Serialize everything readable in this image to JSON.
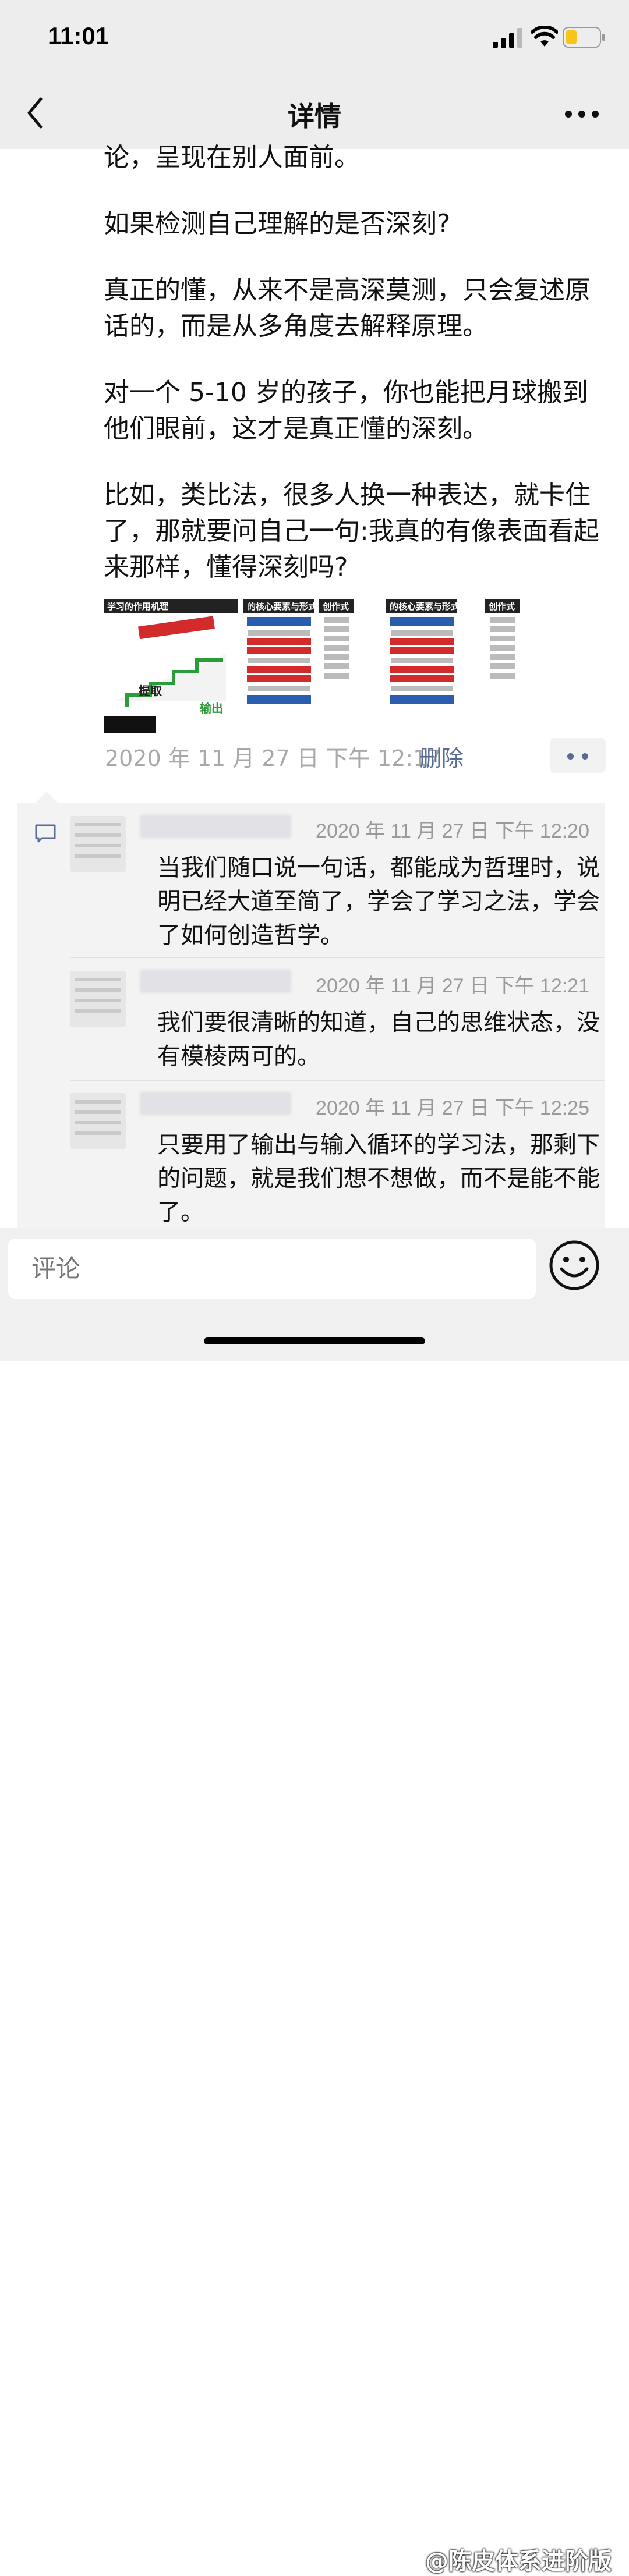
{
  "status_bar": {
    "time": "11:01"
  },
  "nav": {
    "title": "详情"
  },
  "post": {
    "paragraphs": [
      "论，呈现在别人面前。",
      "如果检测自己理解的是否深刻?",
      "真正的懂，从来不是高深莫测，只会复述原话的，而是从多角度去解释原理。",
      "对一个 5-10 岁的孩子，你也能把月球搬到他们眼前，这才是真正懂的深刻。",
      "比如，类比法，很多人换一种表达，就卡住了，那就要问自己一句:我真的有像表面看起来那样，懂得深刻吗?"
    ],
    "thumbnails": [
      {
        "header": "学习的作用机理",
        "tag1": "提取",
        "tag2": "输出"
      },
      {
        "header": "的核心要素与形式"
      },
      {
        "header": "创作式"
      },
      {
        "header": "的核心要素与形式"
      },
      {
        "header": "创作式"
      }
    ],
    "time": "2020 年 11 月 27 日  下午 12:17",
    "delete_label": "删除"
  },
  "comments": [
    {
      "time": "2020 年 11 月 27 日  下午 12:20",
      "text": "当我们随口说一句话，都能成为哲理时，说明已经大道至简了，学会了学习之法，学会了如何创造哲学。"
    },
    {
      "time": "2020 年 11 月 27 日  下午 12:21",
      "text": "我们要很清晰的知道，自己的思维状态，没有模棱两可的。"
    },
    {
      "time": "2020 年 11 月 27 日  下午 12:25",
      "text": "只要用了输出与输入循环的学习法，那剩下的问题，就是我们想不想做，而不是能不能了。"
    }
  ],
  "input": {
    "placeholder": "评论"
  },
  "watermark": "@陈皮体系进阶版",
  "colors": {
    "link": "#576b95",
    "bar": "#ededed"
  },
  "icons": [
    "back-icon",
    "more-icon",
    "comment-icon",
    "emoji-icon",
    "signal-icon",
    "wifi-icon",
    "battery-icon"
  ]
}
